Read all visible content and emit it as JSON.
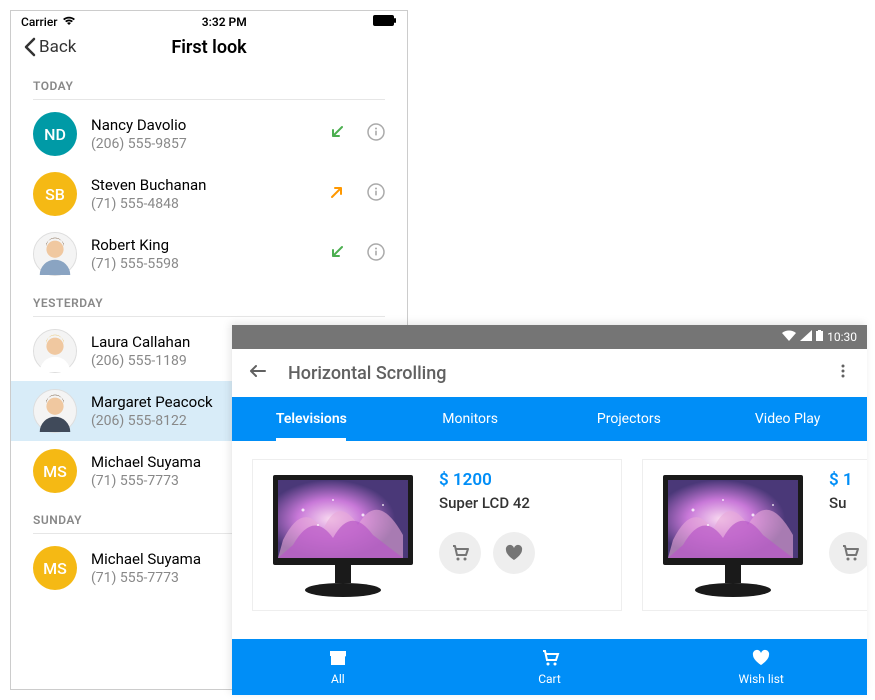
{
  "ios": {
    "status": {
      "carrier": "Carrier",
      "time": "3:32 PM"
    },
    "nav": {
      "back": "Back",
      "title": "First look"
    },
    "sections": {
      "today_label": "TODAY",
      "yesterday_label": "YESTERDAY",
      "sunday_label": "SUNDAY"
    },
    "today": [
      {
        "name": "Nancy Davolio",
        "phone": "(206) 555-9857",
        "initials": "ND",
        "color": "#009aa6",
        "avatar_type": "initials",
        "direction": "in"
      },
      {
        "name": "Steven Buchanan",
        "phone": "(71) 555-4848",
        "initials": "SB",
        "color": "#f5b914",
        "avatar_type": "initials",
        "direction": "out"
      },
      {
        "name": "Robert King",
        "phone": "(71) 555-5598",
        "avatar_type": "photo_male",
        "direction": "in"
      }
    ],
    "yesterday": [
      {
        "name": "Laura Callahan",
        "phone": "(206) 555-1189",
        "avatar_type": "photo_female1"
      },
      {
        "name": "Margaret Peacock",
        "phone": "(206) 555-8122",
        "avatar_type": "photo_female2",
        "selected": true
      },
      {
        "name": "Michael Suyama",
        "phone": "(71) 555-7773",
        "initials": "MS",
        "color": "#f5b914",
        "avatar_type": "initials"
      }
    ],
    "sunday": [
      {
        "name": "Michael Suyama",
        "phone": "(71) 555-7773",
        "initials": "MS",
        "color": "#f5b914",
        "avatar_type": "initials"
      }
    ]
  },
  "android": {
    "status_time": "10:30",
    "title": "Horizontal Scrolling",
    "tabs": [
      {
        "label": "Televisions",
        "active": true
      },
      {
        "label": "Monitors"
      },
      {
        "label": "Projectors"
      },
      {
        "label": "Video Play"
      }
    ],
    "products": [
      {
        "price": "$ 1200",
        "name": "Super LCD 42"
      },
      {
        "price": "$ 1",
        "name": "Su"
      }
    ],
    "bottom": [
      {
        "label": "All",
        "icon": "store"
      },
      {
        "label": "Cart",
        "icon": "cart"
      },
      {
        "label": "Wish list",
        "icon": "heart"
      }
    ]
  }
}
